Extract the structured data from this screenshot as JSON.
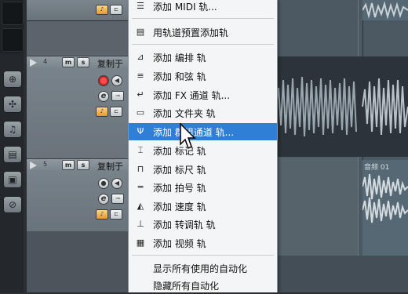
{
  "menu": {
    "items": [
      {
        "icon": "midi-icon",
        "glyph": "☰",
        "label": "添加 MIDI 轨..."
      },
      {
        "icon": "preset-icon",
        "glyph": "▤",
        "label": "用轨道预置添加轨"
      },
      {
        "icon": "arranger-icon",
        "glyph": "⊿",
        "label": "添加 编排 轨"
      },
      {
        "icon": "chord-icon",
        "glyph": "≡",
        "label": "添加 和弦 轨"
      },
      {
        "icon": "fx-icon",
        "glyph": "↵",
        "label": "添加 FX 通道 轨..."
      },
      {
        "icon": "folder-icon",
        "glyph": "▭",
        "label": "添加 文件夹 轨"
      },
      {
        "icon": "group-channel-icon",
        "glyph": "Ψ",
        "label": "添加 群组通道 轨..."
      },
      {
        "icon": "marker-icon",
        "glyph": "⌶",
        "label": "添加 标记 轨"
      },
      {
        "icon": "ruler-icon",
        "glyph": "⊓",
        "label": "添加 标尺 轨"
      },
      {
        "icon": "signature-icon",
        "glyph": "═",
        "label": "添加 拍号 轨"
      },
      {
        "icon": "tempo-icon",
        "glyph": "◭",
        "label": "添加 速度 轨"
      },
      {
        "icon": "transpose-icon",
        "glyph": "⊥",
        "label": "添加 转调轨 轨"
      },
      {
        "icon": "video-icon",
        "glyph": "▦",
        "label": "添加 视频 轨"
      },
      {
        "label": "显示所有使用的自动化"
      },
      {
        "label": "隐藏所有自动化"
      }
    ],
    "highlight_color": "#2f7fd6"
  },
  "tracks": [
    {
      "number": "4",
      "mute": "m",
      "solo": "s",
      "name": "复制于",
      "clip": ""
    },
    {
      "number": "5",
      "mute": "m",
      "solo": "s",
      "name": "复制于",
      "clip": "音频 01"
    }
  ],
  "tools": [
    "tool-1-icon",
    "tool-2-icon",
    "tool-3-icon",
    "tool-4-icon",
    "tool-5-icon",
    "tool-6-icon"
  ]
}
